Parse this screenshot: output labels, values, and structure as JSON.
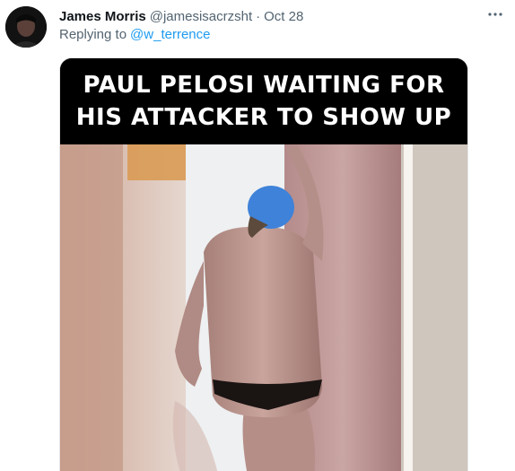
{
  "tweet": {
    "author_name": "James Morris",
    "handle": "@jamesisacrzsht",
    "separator": "·",
    "date": "Oct 28",
    "replying_to_label": "Replying to",
    "replying_to_handle": "@w_terrence",
    "more_icon": "more-horizontal-icon"
  },
  "media": {
    "caption": "PAUL PELOSI WAITING FOR\nHIS ATTACKER TO SHOW UP"
  },
  "colors": {
    "text_primary": "#0f1419",
    "text_secondary": "#536471",
    "link": "#1d9bf0",
    "caption_bg": "#000000",
    "caption_text": "#ffffff"
  }
}
